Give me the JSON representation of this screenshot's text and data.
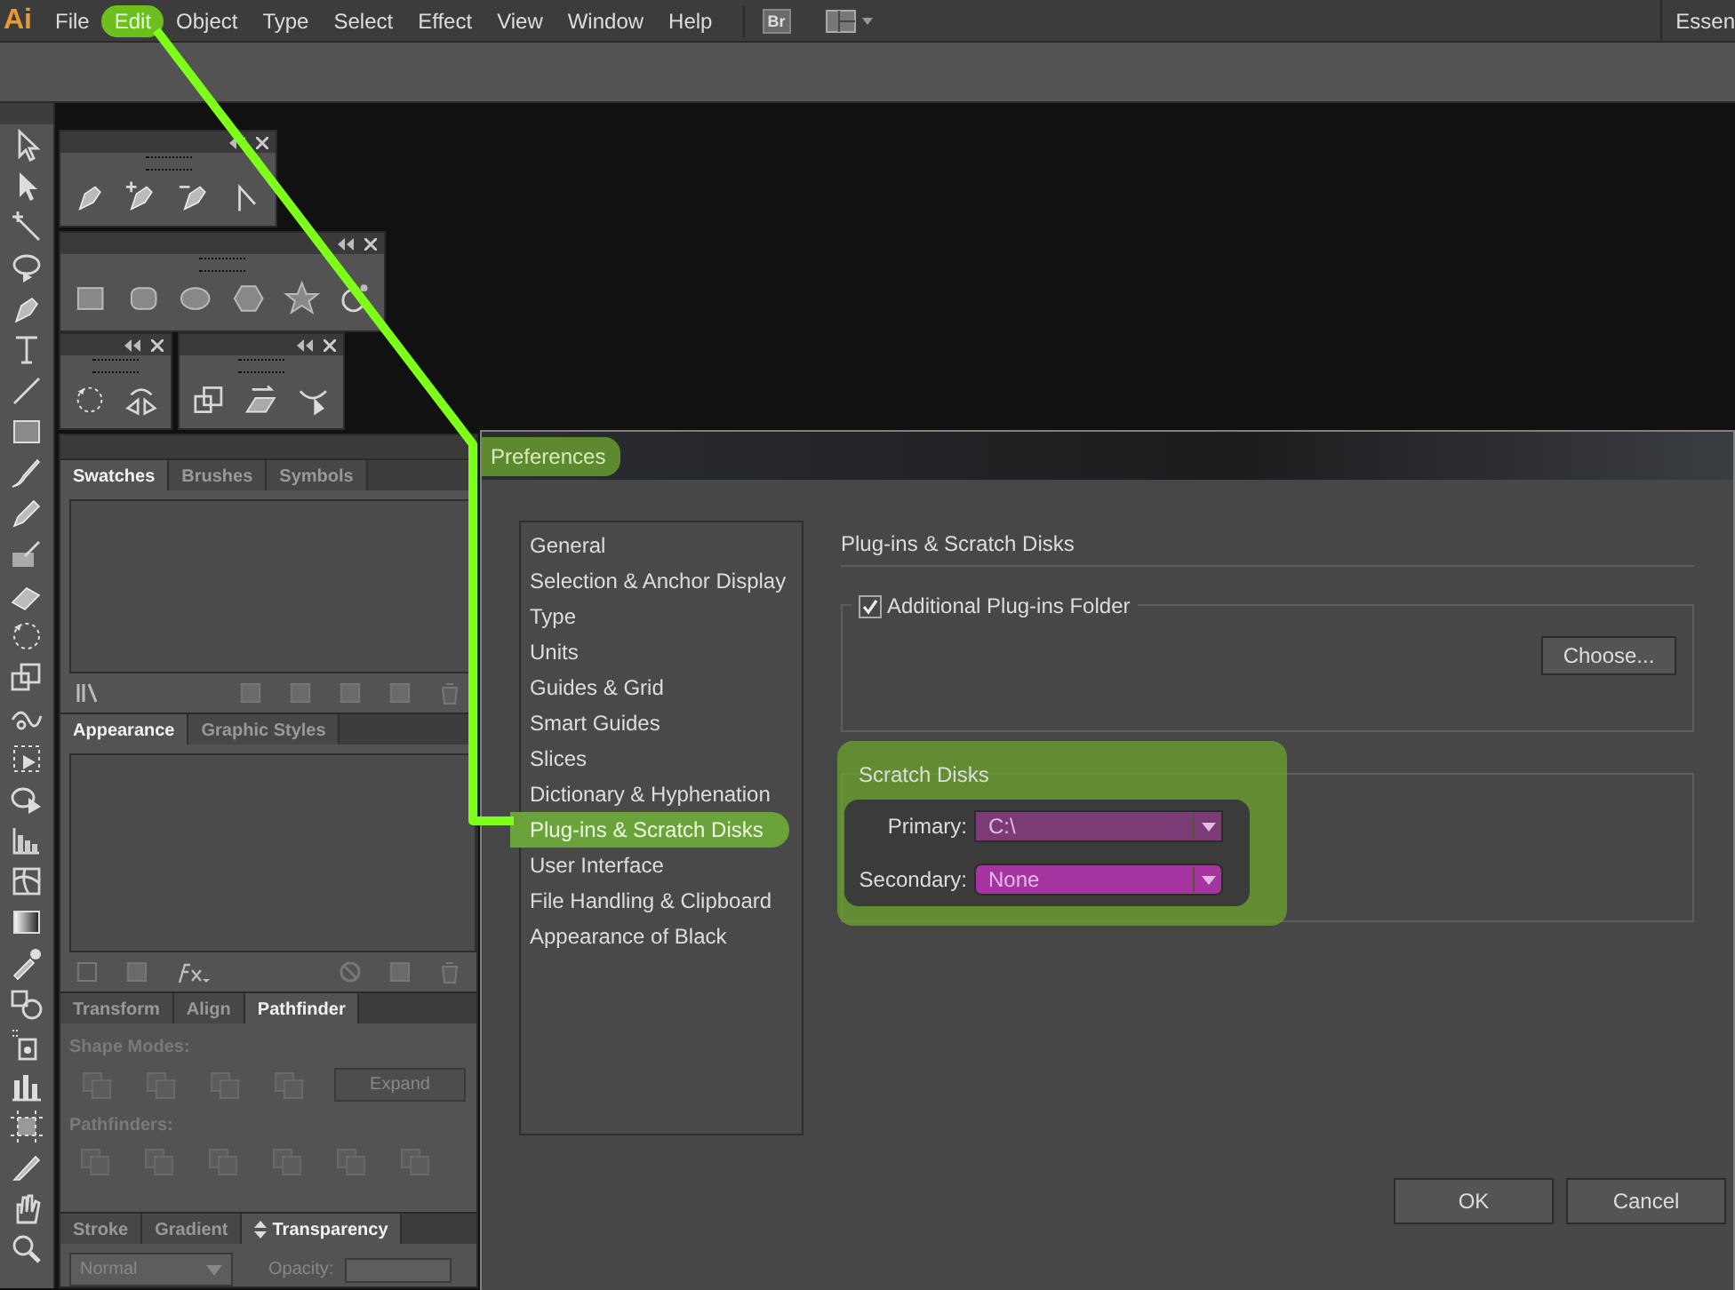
{
  "menu_bar": {
    "logo": "Ai",
    "items": [
      {
        "label": "File",
        "highlighted": false
      },
      {
        "label": "Edit",
        "highlighted": true
      },
      {
        "label": "Object",
        "highlighted": false
      },
      {
        "label": "Type",
        "highlighted": false
      },
      {
        "label": "Select",
        "highlighted": false
      },
      {
        "label": "Effect",
        "highlighted": false
      },
      {
        "label": "View",
        "highlighted": false
      },
      {
        "label": "Window",
        "highlighted": false
      },
      {
        "label": "Help",
        "highlighted": false
      }
    ],
    "bridge_button": "Br",
    "workspace": "Essen"
  },
  "panels": [
    {
      "kind": "swatches",
      "tabs": [
        {
          "label": "Swatches",
          "selected": true
        },
        {
          "label": "Brushes",
          "selected": false
        },
        {
          "label": "Symbols",
          "selected": false
        }
      ]
    },
    {
      "kind": "appearance",
      "tabs": [
        {
          "label": "Appearance",
          "selected": true
        },
        {
          "label": "Graphic Styles",
          "selected": false
        }
      ]
    },
    {
      "kind": "pathfinder",
      "tabs": [
        {
          "label": "Transform",
          "selected": false
        },
        {
          "label": "Align",
          "selected": false
        },
        {
          "label": "Pathfinder",
          "selected": true
        }
      ],
      "shape_modes_label": "Shape Modes:",
      "expand_button": "Expand",
      "pathfinders_label": "Pathfinders:"
    },
    {
      "kind": "transparency",
      "tabs": [
        {
          "label": "Stroke",
          "selected": false
        },
        {
          "label": "Gradient",
          "selected": false
        },
        {
          "label": "Transparency",
          "selected": true
        }
      ],
      "blend_mode": "Normal",
      "opacity_label": "Opacity:"
    }
  ],
  "preferences": {
    "title": "Preferences",
    "title_highlighted": true,
    "categories": [
      {
        "label": "General",
        "selected": false
      },
      {
        "label": "Selection & Anchor Display",
        "selected": false
      },
      {
        "label": "Type",
        "selected": false
      },
      {
        "label": "Units",
        "selected": false
      },
      {
        "label": "Guides & Grid",
        "selected": false
      },
      {
        "label": "Smart Guides",
        "selected": false
      },
      {
        "label": "Slices",
        "selected": false
      },
      {
        "label": "Dictionary & Hyphenation",
        "selected": false
      },
      {
        "label": "Plug-ins & Scratch Disks",
        "selected": true
      },
      {
        "label": "User Interface",
        "selected": false
      },
      {
        "label": "File Handling & Clipboard",
        "selected": false
      },
      {
        "label": "Appearance of Black",
        "selected": false
      }
    ],
    "section_title": "Plug-ins & Scratch Disks",
    "plugins_folder": {
      "label": "Additional Plug-ins Folder",
      "checked": true
    },
    "choose_button": "Choose...",
    "scratch_disks": {
      "title": "Scratch Disks",
      "highlighted": true,
      "primary_label": "Primary:",
      "primary_value": "C:\\",
      "secondary_label": "Secondary:",
      "secondary_value": "None"
    },
    "buttons": [
      "OK",
      "Cancel"
    ]
  }
}
